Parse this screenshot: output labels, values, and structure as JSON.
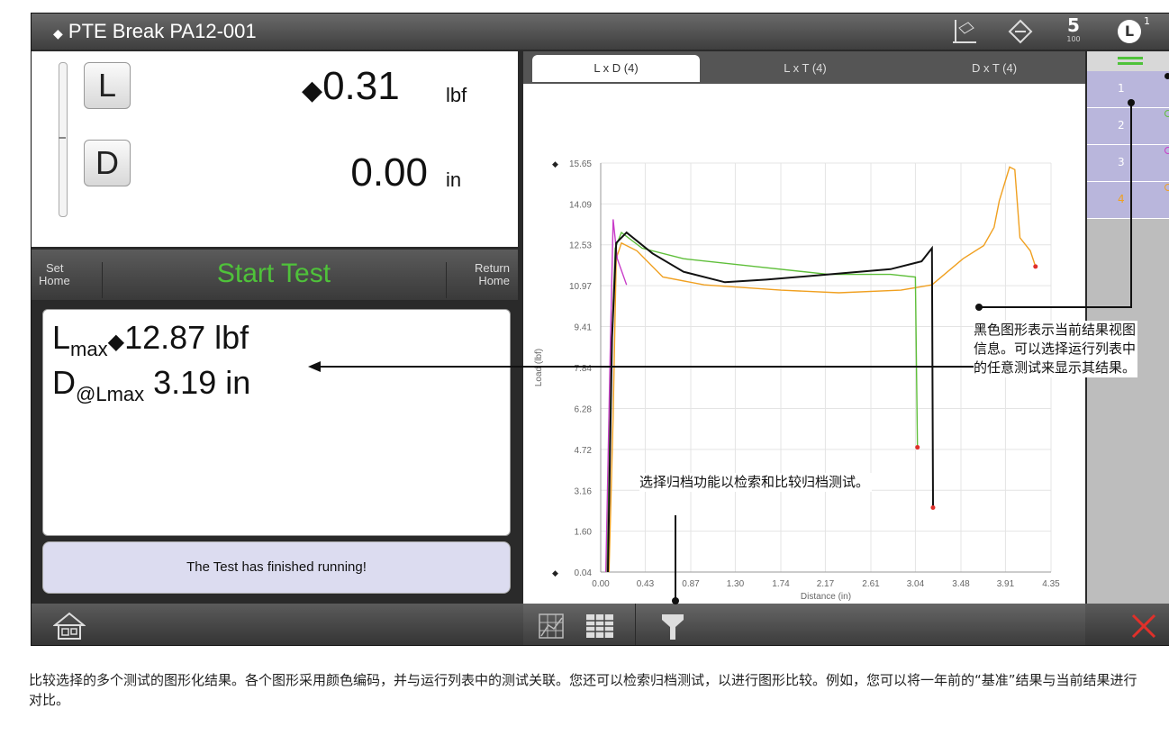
{
  "title": "PTE Break PA12-001",
  "header_icons": [
    "chart-axes-icon",
    "diamond-icon",
    "counter-icon",
    "user-icon"
  ],
  "counter": {
    "top": "5",
    "bottom": "100"
  },
  "user_badge": "1",
  "readout": {
    "load_key": "L",
    "load_value": "0.31",
    "load_unit": "lbf",
    "disp_key": "D",
    "disp_value": "0.00",
    "disp_unit": "in"
  },
  "controls": {
    "set_home_1": "Set",
    "set_home_2": "Home",
    "start_test": "Start Test",
    "return_home_1": "Return",
    "return_home_2": "Home"
  },
  "results": {
    "lmax_label": "L",
    "lmax_sub": "max",
    "lmax_value": "12.87 lbf",
    "dmax_label": "D",
    "dmax_sub": "@Lmax",
    "dmax_value": "3.19 in"
  },
  "status_message": "The Test has finished running!",
  "tabs": [
    "L x D (4)",
    "L x T (4)",
    "D x T (4)"
  ],
  "run_list": [
    "1",
    "2",
    "3",
    "4"
  ],
  "run_colors": [
    "#111111",
    "#5fbf3a",
    "#c83cc8",
    "#f0a020"
  ],
  "chart_data": {
    "type": "line",
    "xlabel": "Distance (in)",
    "ylabel": "Load (lbf)",
    "xticks": [
      "0.00",
      "0.43",
      "0.87",
      "1.30",
      "1.74",
      "2.17",
      "2.61",
      "3.04",
      "3.48",
      "3.91",
      "4.35"
    ],
    "yticks": [
      "0.04",
      "1.60",
      "3.16",
      "4.72",
      "6.28",
      "7.84",
      "9.41",
      "10.97",
      "12.53",
      "14.09",
      "15.65"
    ],
    "xlim": [
      0,
      4.35
    ],
    "ylim": [
      0.04,
      15.65
    ],
    "grid": true,
    "series": [
      {
        "color": "#f0a020",
        "points": [
          [
            0.08,
            0.04
          ],
          [
            0.12,
            6
          ],
          [
            0.15,
            12.0
          ],
          [
            0.2,
            12.6
          ],
          [
            0.35,
            12.3
          ],
          [
            0.6,
            11.3
          ],
          [
            1.0,
            11.0
          ],
          [
            1.74,
            10.8
          ],
          [
            2.3,
            10.7
          ],
          [
            2.9,
            10.8
          ],
          [
            3.2,
            11.0
          ],
          [
            3.5,
            12.0
          ],
          [
            3.7,
            12.5
          ],
          [
            3.8,
            13.2
          ],
          [
            3.85,
            14.2
          ],
          [
            3.95,
            15.5
          ],
          [
            4.0,
            15.4
          ],
          [
            4.05,
            12.8
          ],
          [
            4.15,
            12.3
          ],
          [
            4.2,
            11.7
          ]
        ]
      },
      {
        "color": "#5fbf3a",
        "points": [
          [
            0.06,
            0.04
          ],
          [
            0.1,
            8
          ],
          [
            0.14,
            12.4
          ],
          [
            0.2,
            13.0
          ],
          [
            0.4,
            12.4
          ],
          [
            0.8,
            12.0
          ],
          [
            1.5,
            11.7
          ],
          [
            2.2,
            11.4
          ],
          [
            2.8,
            11.4
          ],
          [
            3.04,
            11.3
          ],
          [
            3.06,
            4.8
          ]
        ]
      },
      {
        "color": "#c83cc8",
        "points": [
          [
            0.05,
            0.04
          ],
          [
            0.09,
            8
          ],
          [
            0.12,
            13.5
          ],
          [
            0.16,
            12.0
          ],
          [
            0.25,
            11.0
          ]
        ]
      },
      {
        "color": "#111111",
        "points": [
          [
            0.07,
            0.04
          ],
          [
            0.11,
            9
          ],
          [
            0.15,
            12.6
          ],
          [
            0.25,
            13.0
          ],
          [
            0.5,
            12.2
          ],
          [
            0.8,
            11.5
          ],
          [
            1.2,
            11.1
          ],
          [
            1.6,
            11.2
          ],
          [
            2.2,
            11.4
          ],
          [
            2.8,
            11.6
          ],
          [
            3.1,
            11.9
          ],
          [
            3.2,
            12.4
          ],
          [
            3.21,
            2.5
          ]
        ]
      }
    ],
    "end_markers": [
      [
        3.06,
        4.8
      ],
      [
        3.21,
        2.5
      ],
      [
        4.2,
        11.7
      ]
    ]
  },
  "annotations": {
    "black_graph": "黑色图形表示当前结果视图信息。可以选择运行列表中的任意测试来显示其结果。",
    "archive": "选择归档功能以检索和比较归档测试。"
  },
  "caption": "比较选择的多个测试的图形化结果。各个图形采用颜色编码，并与运行列表中的测试关联。您还可以检索归档测试，以进行图形比较。例如，您可以将一年前的“基准”结果与当前结果进行对比。"
}
